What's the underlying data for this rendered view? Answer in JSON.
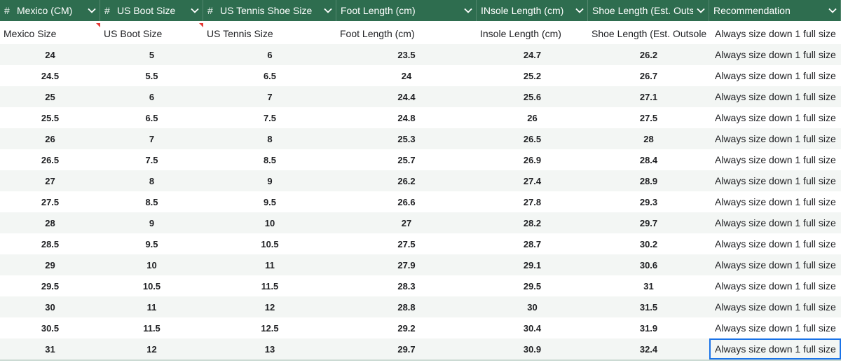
{
  "header": {
    "columns": [
      {
        "label": "Mexico (CM)",
        "numeric": true
      },
      {
        "label": "US Boot Size",
        "numeric": true
      },
      {
        "label": "US Tennis Shoe Size",
        "numeric": true
      },
      {
        "label": "Foot Length (cm)",
        "numeric": false
      },
      {
        "label": "INsole Length (cm)",
        "numeric": false
      },
      {
        "label": "Shoe Length (Est. Outs",
        "numeric": false
      },
      {
        "label": "Recommendation",
        "numeric": false
      }
    ],
    "hash_symbol": "#"
  },
  "label_row": [
    "Mexico Size",
    "US Boot Size",
    "US Tennis Size",
    "Foot Length (cm)",
    "Insole Length (cm)",
    "Shoe Length (Est. Outsole (",
    "Always size down 1 full size"
  ],
  "rows": [
    [
      "24",
      "5",
      "6",
      "23.5",
      "24.7",
      "26.2",
      "Always size down 1 full size"
    ],
    [
      "24.5",
      "5.5",
      "6.5",
      "24",
      "25.2",
      "26.7",
      "Always size down 1 full size"
    ],
    [
      "25",
      "6",
      "7",
      "24.4",
      "25.6",
      "27.1",
      "Always size down 1 full size"
    ],
    [
      "25.5",
      "6.5",
      "7.5",
      "24.8",
      "26",
      "27.5",
      "Always size down 1 full size"
    ],
    [
      "26",
      "7",
      "8",
      "25.3",
      "26.5",
      "28",
      "Always size down 1 full size"
    ],
    [
      "26.5",
      "7.5",
      "8.5",
      "25.7",
      "26.9",
      "28.4",
      "Always size down 1 full size"
    ],
    [
      "27",
      "8",
      "9",
      "26.2",
      "27.4",
      "28.9",
      "Always size down 1 full size"
    ],
    [
      "27.5",
      "8.5",
      "9.5",
      "26.6",
      "27.8",
      "29.3",
      "Always size down 1 full size"
    ],
    [
      "28",
      "9",
      "10",
      "27",
      "28.2",
      "29.7",
      "Always size down 1 full size"
    ],
    [
      "28.5",
      "9.5",
      "10.5",
      "27.5",
      "28.7",
      "30.2",
      "Always size down 1 full size"
    ],
    [
      "29",
      "10",
      "11",
      "27.9",
      "29.1",
      "30.6",
      "Always size down 1 full size"
    ],
    [
      "29.5",
      "10.5",
      "11.5",
      "28.3",
      "29.5",
      "31",
      "Always size down 1 full size"
    ],
    [
      "30",
      "11",
      "12",
      "28.8",
      "30",
      "31.5",
      "Always size down 1 full size"
    ],
    [
      "30.5",
      "11.5",
      "12.5",
      "29.2",
      "30.4",
      "31.9",
      "Always size down 1 full size"
    ],
    [
      "31",
      "12",
      "13",
      "29.7",
      "30.9",
      "32.4",
      "Always size down 1 full size"
    ]
  ],
  "colors": {
    "header_bg": "#2e6d4f",
    "band_bg": "#f3f6f4",
    "note_marker": "#e53935",
    "selection": "#1a73e8"
  },
  "icons": {
    "dropdown": "chevron-down-icon",
    "note": "comment-marker"
  }
}
